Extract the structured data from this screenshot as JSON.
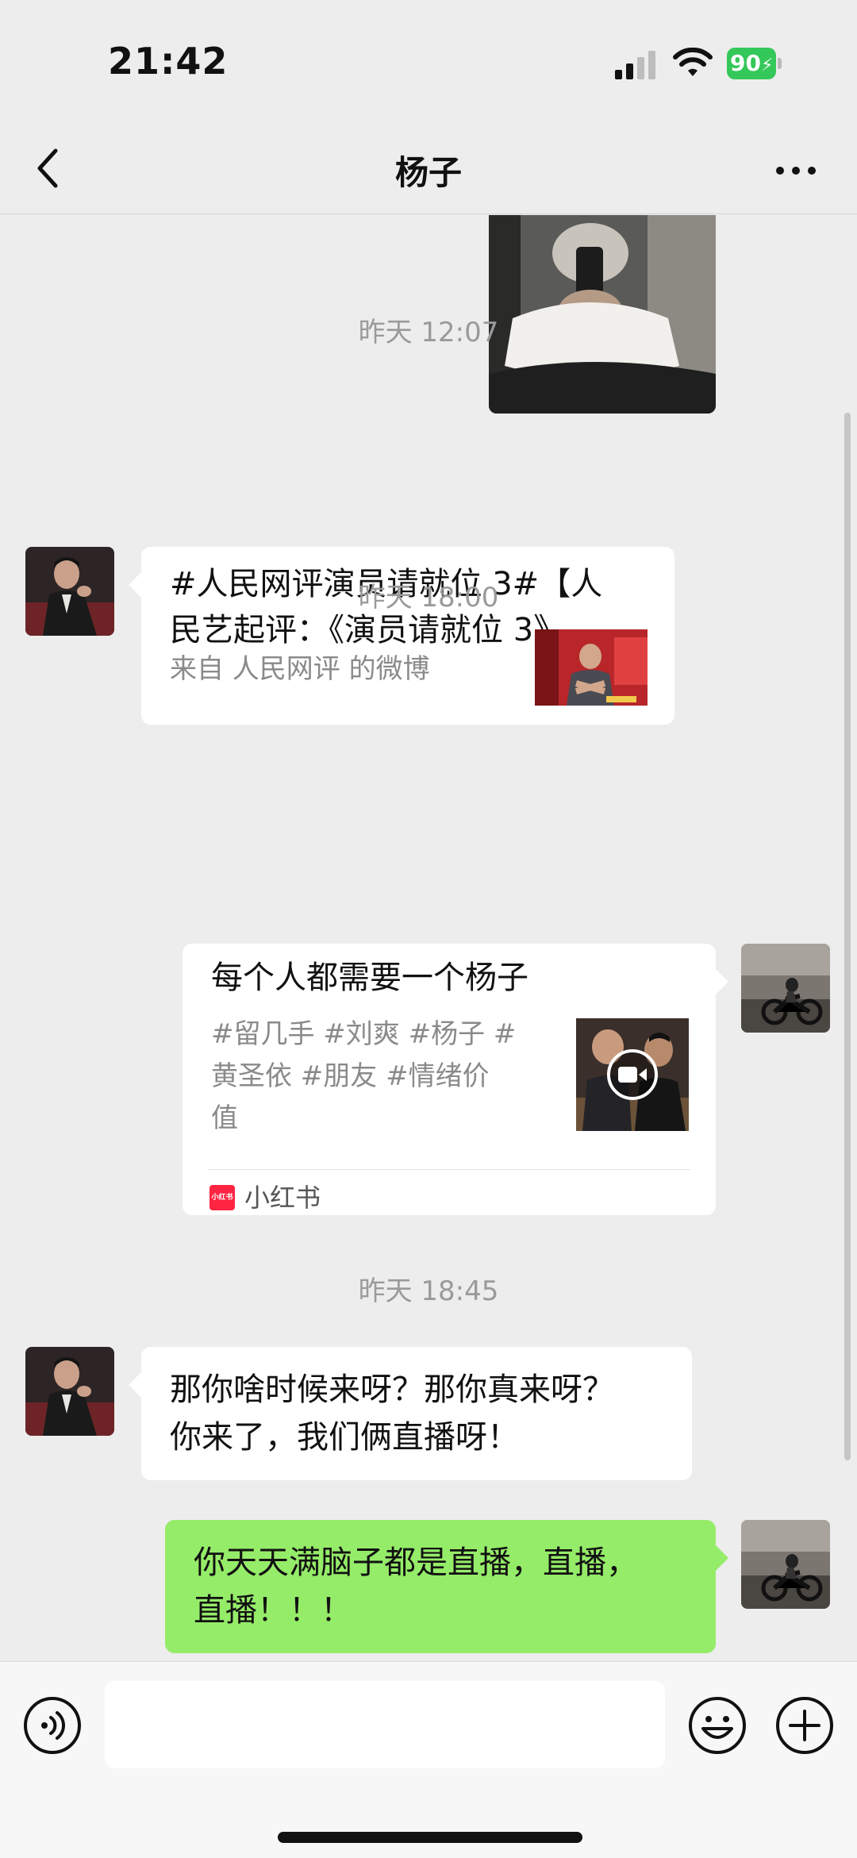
{
  "status_bar": {
    "time": "21:42",
    "battery": "90"
  },
  "nav": {
    "title": "杨子"
  },
  "messages": {
    "timestamp_1": "昨天 12:07",
    "weibo_card": {
      "title": "#人民网评演员请就位 3#【人民艺起评：《演员请就位 3》...",
      "title_line1": "#人民网评演员请就位 3#【人",
      "title_line2": "民艺起评：《演员请就位 3》...",
      "source": "来自 人民网评 的微博"
    },
    "timestamp_2": "昨天 18:00",
    "xhs_card": {
      "title": "每个人都需要一个杨子",
      "tags_line1": "#留几手 #刘爽 #杨子 #",
      "tags_line2": "黄圣依 #朋友 #情绪价",
      "tags_line3": "值",
      "source_logo": "小红书",
      "source": "小红书"
    },
    "timestamp_3": "昨天 18:45",
    "incoming_text": {
      "line1": "那你啥时候来呀？那你真来呀？",
      "line2": "你来了，我们俩直播呀！"
    },
    "outgoing_text": {
      "line1": "你天天满脑子都是直播，直播，",
      "line2": "直播！！！"
    }
  },
  "input_bar": {
    "placeholder": ""
  },
  "icons": [
    "chevron-left-icon",
    "more-icon",
    "voice-icon",
    "emoji-icon",
    "plus-icon",
    "play-icon"
  ],
  "colors": {
    "background": "#ededed",
    "outgoing_bubble": "#95ec69",
    "incoming_bubble": "#ffffff",
    "battery": "#34c759",
    "xhs_red": "#ff2442"
  }
}
